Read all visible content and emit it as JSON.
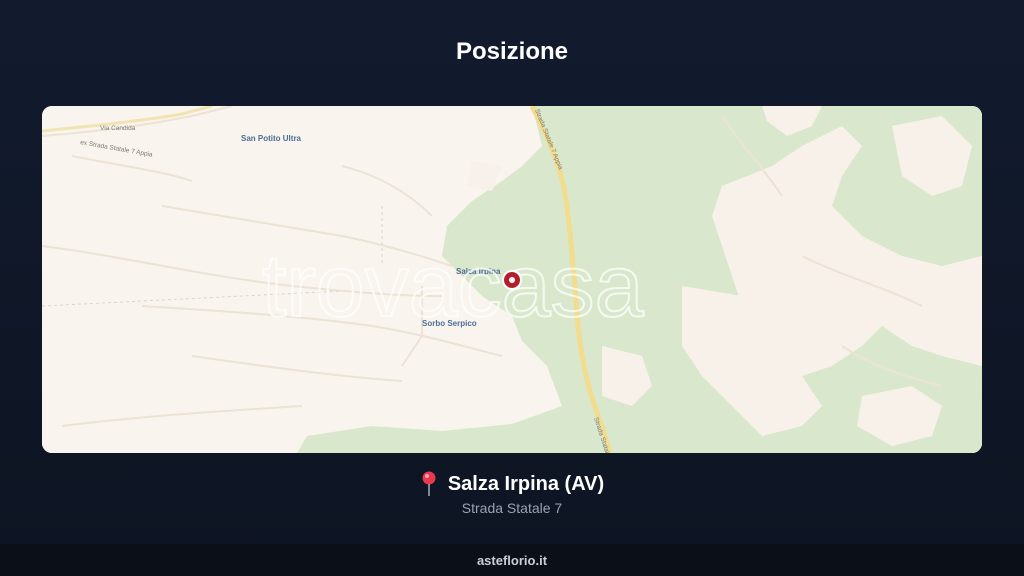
{
  "header": {
    "title": "Posizione"
  },
  "map": {
    "places": {
      "san_potito": "San Potito Ultra",
      "salza": "Salza Irpina",
      "sorbo": "Sorbo Serpico"
    },
    "roads": {
      "via_candida": "Via Candida",
      "ss7_west": "ex Strada Statale 7 Appia",
      "ss7_north": "Strada Statale 7 Appia",
      "ss7_south": "Strada Statale"
    },
    "watermark": "trovacasa",
    "colors": {
      "background": "#f9f4ee",
      "forest": "#d9e8cc",
      "main_road": "#f2dc8e",
      "marker": "#b3202c"
    }
  },
  "location": {
    "icon": "map-pin-icon",
    "name": "Salza Irpina (AV)",
    "address": "Strada Statale 7"
  },
  "footer": {
    "text": "asteflorio.it"
  }
}
